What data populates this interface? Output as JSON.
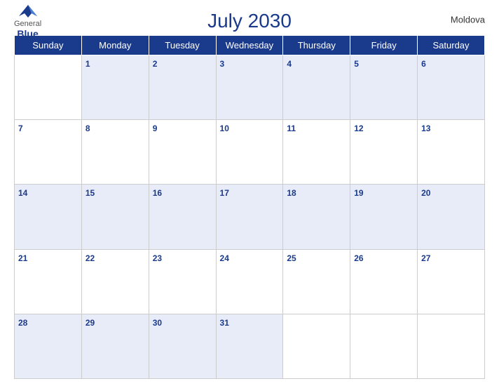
{
  "header": {
    "title": "July 2030",
    "country": "Moldova",
    "logo": {
      "line1": "General",
      "line2": "Blue"
    }
  },
  "days_of_week": [
    "Sunday",
    "Monday",
    "Tuesday",
    "Wednesday",
    "Thursday",
    "Friday",
    "Saturday"
  ],
  "weeks": [
    [
      null,
      1,
      2,
      3,
      4,
      5,
      6
    ],
    [
      7,
      8,
      9,
      10,
      11,
      12,
      13
    ],
    [
      14,
      15,
      16,
      17,
      18,
      19,
      20
    ],
    [
      21,
      22,
      23,
      24,
      25,
      26,
      27
    ],
    [
      28,
      29,
      30,
      31,
      null,
      null,
      null
    ]
  ]
}
